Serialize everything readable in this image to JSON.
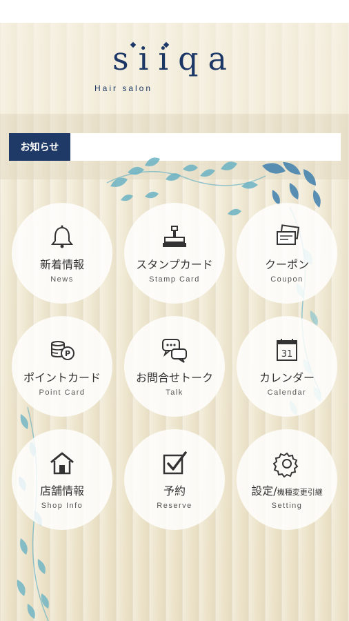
{
  "app": {
    "logo_text": "siiqa",
    "logo_subtitle": "Hair salon"
  },
  "news": {
    "label": "お知らせ",
    "text": ""
  },
  "menu": [
    {
      "jp": "新着情報",
      "en": "News",
      "icon": "bell-icon"
    },
    {
      "jp": "スタンプカード",
      "en": "Stamp Card",
      "icon": "stamp-icon"
    },
    {
      "jp": "クーポン",
      "en": "Coupon",
      "icon": "coupon-icon"
    },
    {
      "jp": "ポイントカード",
      "en": "Point Card",
      "icon": "points-coins-icon"
    },
    {
      "jp": "お問合せトーク",
      "en": "Talk",
      "icon": "chat-bubbles-icon"
    },
    {
      "jp": "カレンダー",
      "en": "Calendar",
      "icon": "calendar-icon",
      "calendar_day": "31"
    },
    {
      "jp": "店舗情報",
      "en": "Shop Info",
      "icon": "house-icon"
    },
    {
      "jp": "予約",
      "en": "Reserve",
      "icon": "checkbox-icon"
    },
    {
      "jp": "設定/",
      "jp_small": "機種変更引継",
      "en": "Setting",
      "icon": "gear-icon"
    }
  ],
  "colors": {
    "brand": "#1c3766",
    "news_label_bg": "#1f3a66",
    "leaf": "#5aa6b8"
  }
}
